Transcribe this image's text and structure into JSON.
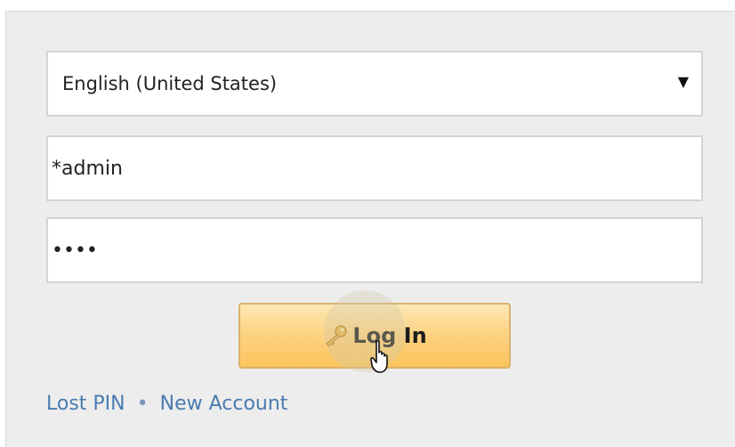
{
  "login": {
    "language": {
      "selected": "English (United States)",
      "arrow_icon": "dropdown-arrow-icon"
    },
    "username": {
      "value": "*admin"
    },
    "password": {
      "masked_value": "••••"
    },
    "submit": {
      "label": "Log In",
      "icon": "key-icon"
    },
    "links": {
      "lost_pin": "Lost PIN",
      "separator": "•",
      "new_account": "New Account"
    }
  },
  "colors": {
    "panel_bg": "#ededed",
    "button_gradient_top": "#fde8b4",
    "button_gradient_bottom": "#fbc45c",
    "link": "#4a7bb0"
  }
}
